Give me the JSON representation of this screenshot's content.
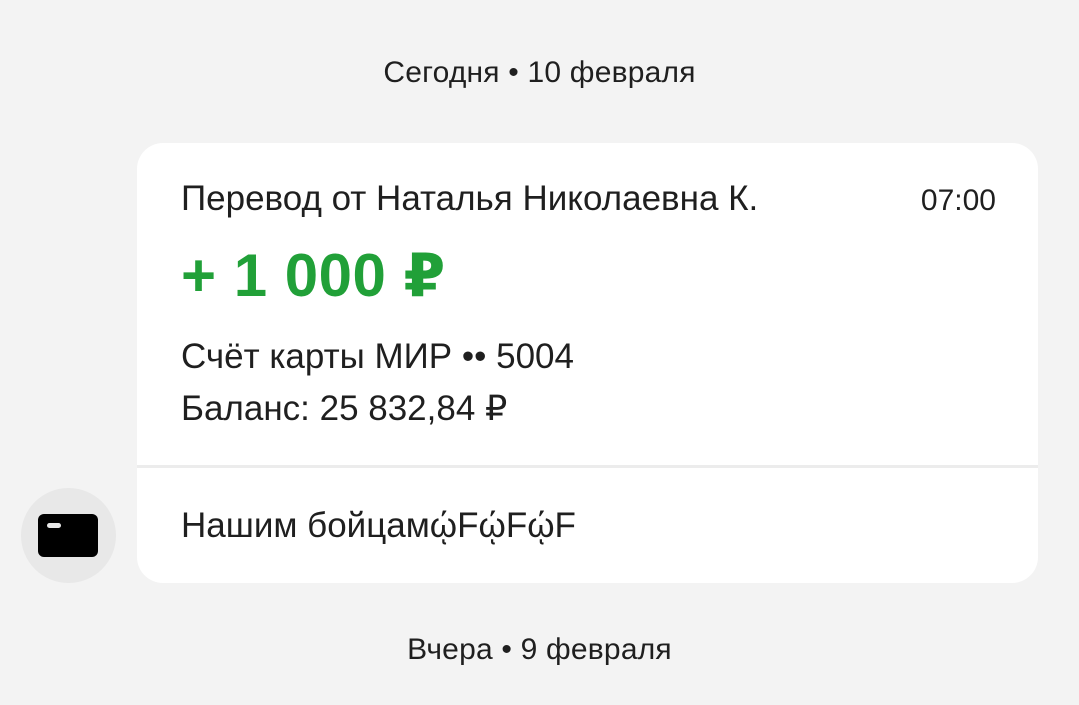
{
  "dates": {
    "today": "Сегодня • 10 февраля",
    "yesterday": "Вчера • 9 февраля"
  },
  "transfer": {
    "title": "Перевод от Наталья Николаевна К.",
    "time": "07:00",
    "amount": "+ 1 000 ₽",
    "account": "Счёт карты МИР •• 5004",
    "balance": "Баланс: 25 832,84 ₽",
    "message": "Нашим бойцамῴFῴFῴF",
    "amount_color": "#21a038"
  },
  "avatar": {
    "icon": "bank-card-icon"
  }
}
